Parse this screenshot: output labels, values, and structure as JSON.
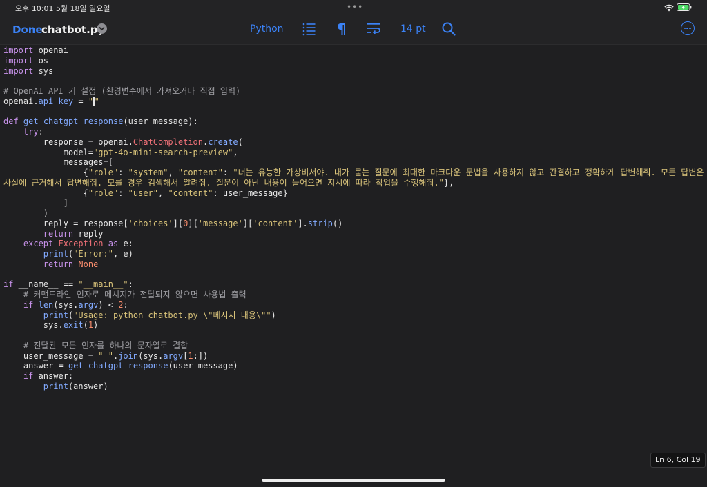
{
  "status_bar": {
    "time": "오후 10:01  5월 18일 일요일",
    "dots": "•••"
  },
  "toolbar": {
    "done_label": "Done",
    "filename": "chatbot.py",
    "language": "Python",
    "font_size": "14 pt",
    "accent_color": "#3b82f6",
    "icons": [
      "chevron-down-icon",
      "list-icon",
      "pilcrow-icon",
      "wrap-icon",
      "search-icon",
      "more-icon"
    ]
  },
  "status": {
    "position": "Ln 6, Col 19"
  },
  "syntax_colors": {
    "keyword": "#c792ea",
    "function": "#82aaff",
    "string": "#d9c37a",
    "number": "#f78c6c",
    "comment": "#9e9ea3"
  },
  "editor": {
    "lines": [
      [
        [
          "kw",
          "import"
        ],
        [
          "pl",
          " openai"
        ]
      ],
      [
        [
          "kw",
          "import"
        ],
        [
          "pl",
          " os"
        ]
      ],
      [
        [
          "kw",
          "import"
        ],
        [
          "pl",
          " sys"
        ]
      ],
      [],
      [
        [
          "cm",
          "# OpenAI API 키 설정 (환경변수에서 가져오거나 직접 입력)"
        ]
      ],
      [
        [
          "pl",
          "openai."
        ],
        [
          "fn",
          "api_key"
        ],
        [
          "pl",
          " = "
        ],
        [
          "str",
          "\""
        ],
        [
          "cursor",
          ""
        ],
        [
          "str",
          "\""
        ]
      ],
      [],
      [
        [
          "kw",
          "def"
        ],
        [
          "pl",
          " "
        ],
        [
          "fn",
          "get_chatgpt_response"
        ],
        [
          "pl",
          "(user_message):"
        ]
      ],
      [
        [
          "pl",
          "    "
        ],
        [
          "kw",
          "try"
        ],
        [
          "pl",
          ":"
        ]
      ],
      [
        [
          "pl",
          "        response = openai."
        ],
        [
          "ex",
          "ChatCompletion"
        ],
        [
          "pl",
          "."
        ],
        [
          "fn",
          "create"
        ],
        [
          "pl",
          "("
        ]
      ],
      [
        [
          "pl",
          "            model="
        ],
        [
          "str",
          "\"gpt-4o-mini-search-preview\""
        ],
        [
          "pl",
          ","
        ]
      ],
      [
        [
          "pl",
          "            messages=["
        ]
      ],
      [
        [
          "pl",
          "                {"
        ],
        [
          "str",
          "\"role\""
        ],
        [
          "pl",
          ": "
        ],
        [
          "str",
          "\"system\""
        ],
        [
          "pl",
          ", "
        ],
        [
          "str",
          "\"content\""
        ],
        [
          "pl",
          ": "
        ],
        [
          "str",
          "\"너는 유능한 가상비서야. 내가 묻는 질문에 최대한 마크다운 문법을 사용하지 않고 간결하고 정확하게 답변해줘. 모든 답변은 사실에 근거해서 답변해줘. 모를 경우 검색해서 알려줘. 질문이 아닌 내용이 들어오면 지시에 따라 작업을 수행해줘.\""
        ],
        [
          "pl",
          "},"
        ]
      ],
      [
        [
          "pl",
          "                {"
        ],
        [
          "str",
          "\"role\""
        ],
        [
          "pl",
          ": "
        ],
        [
          "str",
          "\"user\""
        ],
        [
          "pl",
          ", "
        ],
        [
          "str",
          "\"content\""
        ],
        [
          "pl",
          ": user_message}"
        ]
      ],
      [
        [
          "pl",
          "            ]"
        ]
      ],
      [
        [
          "pl",
          "        )"
        ]
      ],
      [
        [
          "pl",
          "        reply = response["
        ],
        [
          "str",
          "'choices'"
        ],
        [
          "pl",
          "]["
        ],
        [
          "num",
          "0"
        ],
        [
          "pl",
          "]["
        ],
        [
          "str",
          "'message'"
        ],
        [
          "pl",
          "]["
        ],
        [
          "str",
          "'content'"
        ],
        [
          "pl",
          "]."
        ],
        [
          "fn",
          "strip"
        ],
        [
          "pl",
          "()"
        ]
      ],
      [
        [
          "pl",
          "        "
        ],
        [
          "kw",
          "return"
        ],
        [
          "pl",
          " reply"
        ]
      ],
      [
        [
          "pl",
          "    "
        ],
        [
          "kw",
          "except"
        ],
        [
          "pl",
          " "
        ],
        [
          "ex",
          "Exception"
        ],
        [
          "pl",
          " "
        ],
        [
          "kw",
          "as"
        ],
        [
          "pl",
          " e:"
        ]
      ],
      [
        [
          "pl",
          "        "
        ],
        [
          "fn",
          "print"
        ],
        [
          "pl",
          "("
        ],
        [
          "str",
          "\"Error:\""
        ],
        [
          "pl",
          ", e)"
        ]
      ],
      [
        [
          "pl",
          "        "
        ],
        [
          "kw",
          "return"
        ],
        [
          "pl",
          " "
        ],
        [
          "num",
          "None"
        ]
      ],
      [],
      [
        [
          "kw",
          "if"
        ],
        [
          "pl",
          " __name__ == "
        ],
        [
          "str",
          "\"__main__\""
        ],
        [
          "pl",
          ":"
        ]
      ],
      [
        [
          "pl",
          "    "
        ],
        [
          "cm",
          "# 커맨드라인 인자로 메시지가 전달되지 않으면 사용법 출력"
        ]
      ],
      [
        [
          "pl",
          "    "
        ],
        [
          "kw",
          "if"
        ],
        [
          "pl",
          " "
        ],
        [
          "fn",
          "len"
        ],
        [
          "pl",
          "(sys."
        ],
        [
          "fn",
          "argv"
        ],
        [
          "pl",
          ") < "
        ],
        [
          "num",
          "2"
        ],
        [
          "pl",
          ":"
        ]
      ],
      [
        [
          "pl",
          "        "
        ],
        [
          "fn",
          "print"
        ],
        [
          "pl",
          "("
        ],
        [
          "str",
          "\"Usage: python chatbot.py \\\"메시지 내용\\\"\""
        ],
        [
          "pl",
          ")"
        ]
      ],
      [
        [
          "pl",
          "        sys."
        ],
        [
          "fn",
          "exit"
        ],
        [
          "pl",
          "("
        ],
        [
          "num",
          "1"
        ],
        [
          "pl",
          ")"
        ]
      ],
      [],
      [
        [
          "pl",
          "    "
        ],
        [
          "cm",
          "# 전달된 모든 인자를 하나의 문자열로 결합"
        ]
      ],
      [
        [
          "pl",
          "    user_message = "
        ],
        [
          "str",
          "\" \""
        ],
        [
          "pl",
          "."
        ],
        [
          "fn",
          "join"
        ],
        [
          "pl",
          "(sys."
        ],
        [
          "fn",
          "argv"
        ],
        [
          "pl",
          "["
        ],
        [
          "num",
          "1"
        ],
        [
          "pl",
          ":])"
        ]
      ],
      [
        [
          "pl",
          "    answer = "
        ],
        [
          "fn",
          "get_chatgpt_response"
        ],
        [
          "pl",
          "(user_message)"
        ]
      ],
      [
        [
          "pl",
          "    "
        ],
        [
          "kw",
          "if"
        ],
        [
          "pl",
          " answer:"
        ]
      ],
      [
        [
          "pl",
          "        "
        ],
        [
          "fn",
          "print"
        ],
        [
          "pl",
          "(answer)"
        ]
      ]
    ]
  }
}
